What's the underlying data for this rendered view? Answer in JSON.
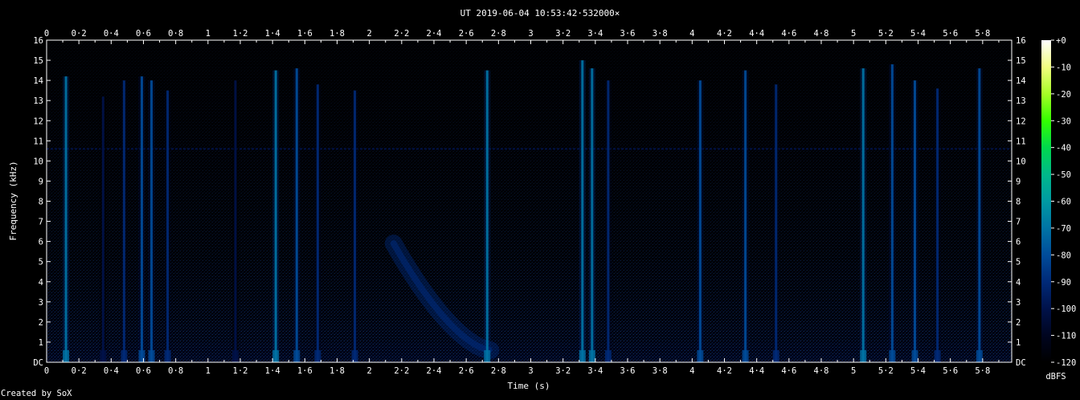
{
  "chart_data": {
    "type": "heatmap",
    "title": "UT 2019-06-04 10:53:42·532000×",
    "xlabel": "Time (s)",
    "ylabel": "Frequency (kHz)",
    "xlim": [
      0,
      5.98
    ],
    "ylim": [
      0,
      16
    ],
    "x_ticks": [
      "0",
      "0·2",
      "0·4",
      "0·6",
      "0·8",
      "1",
      "1·2",
      "1·4",
      "1·6",
      "1·8",
      "2",
      "2·2",
      "2·4",
      "2·6",
      "2·8",
      "3",
      "3·2",
      "3·4",
      "3·6",
      "3·8",
      "4",
      "4·2",
      "4·4",
      "4·6",
      "4·8",
      "5",
      "5·2",
      "5·4",
      "5·6",
      "5·8"
    ],
    "y_ticks": [
      "DC",
      "1",
      "2",
      "3",
      "4",
      "5",
      "6",
      "7",
      "8",
      "9",
      "10",
      "11",
      "12",
      "13",
      "14",
      "15",
      "16"
    ],
    "colorbar": {
      "label": "dBFS",
      "range": [
        -120,
        0
      ],
      "ticks": [
        "+0",
        "-10",
        "-20",
        "-30",
        "-40",
        "-50",
        "-60",
        "-70",
        "-80",
        "-90",
        "-100",
        "-110",
        "-120"
      ],
      "colors": [
        "#ffffff",
        "#f2ff80",
        "#a6ff26",
        "#33ff00",
        "#00d94d",
        "#00b98a",
        "#009aa3",
        "#0074a5",
        "#004c9a",
        "#002a78",
        "#00124a",
        "#000520",
        "#000000"
      ]
    },
    "features": {
      "background_noise_db": -110,
      "steady_tone": {
        "frequency_khz": 10.6,
        "level_db": -95
      },
      "chirp": {
        "start_time_s": 2.15,
        "start_freq_khz": 5.9,
        "end_time_s": 2.75,
        "end_freq_khz": 0.6,
        "level_db": -92
      },
      "impulses": [
        {
          "t": 0.12,
          "top_khz": 14.2,
          "level_db": -72
        },
        {
          "t": 0.35,
          "top_khz": 13.2,
          "level_db": -98
        },
        {
          "t": 0.48,
          "top_khz": 14.0,
          "level_db": -88
        },
        {
          "t": 0.59,
          "top_khz": 14.2,
          "level_db": -78
        },
        {
          "t": 0.65,
          "top_khz": 14.0,
          "level_db": -84
        },
        {
          "t": 0.75,
          "top_khz": 13.5,
          "level_db": -92
        },
        {
          "t": 1.17,
          "top_khz": 14.0,
          "level_db": -98
        },
        {
          "t": 1.42,
          "top_khz": 14.5,
          "level_db": -70
        },
        {
          "t": 1.55,
          "top_khz": 14.6,
          "level_db": -80
        },
        {
          "t": 1.68,
          "top_khz": 13.8,
          "level_db": -93
        },
        {
          "t": 1.91,
          "top_khz": 13.5,
          "level_db": -90
        },
        {
          "t": 2.73,
          "top_khz": 14.5,
          "level_db": -70
        },
        {
          "t": 3.32,
          "top_khz": 15.0,
          "level_db": -68
        },
        {
          "t": 3.38,
          "top_khz": 14.6,
          "level_db": -74
        },
        {
          "t": 3.48,
          "top_khz": 14.0,
          "level_db": -90
        },
        {
          "t": 4.05,
          "top_khz": 14.0,
          "level_db": -76
        },
        {
          "t": 4.33,
          "top_khz": 14.5,
          "level_db": -80
        },
        {
          "t": 4.52,
          "top_khz": 13.8,
          "level_db": -92
        },
        {
          "t": 5.06,
          "top_khz": 14.6,
          "level_db": -74
        },
        {
          "t": 5.24,
          "top_khz": 14.8,
          "level_db": -76
        },
        {
          "t": 5.38,
          "top_khz": 14.0,
          "level_db": -78
        },
        {
          "t": 5.52,
          "top_khz": 13.6,
          "level_db": -86
        },
        {
          "t": 5.78,
          "top_khz": 14.6,
          "level_db": -78
        }
      ]
    }
  },
  "credit": "Created by SoX"
}
